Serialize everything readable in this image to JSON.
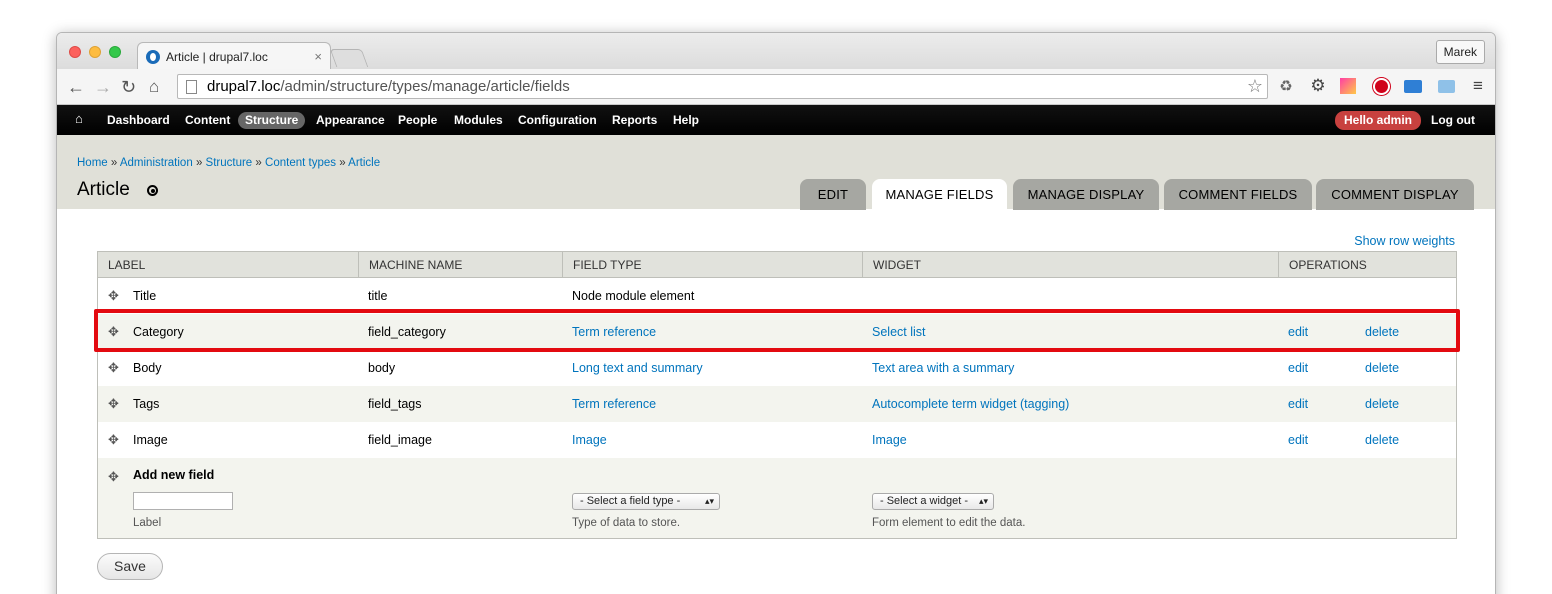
{
  "browser": {
    "tab_title": "Article | drupal7.loc",
    "tab_close": "×",
    "user_button": "Marek",
    "url_host": "drupal7.loc",
    "url_path": "/admin/structure/types/manage/article/fields"
  },
  "admin_menu": {
    "items": [
      "Dashboard",
      "Content",
      "Structure",
      "Appearance",
      "People",
      "Modules",
      "Configuration",
      "Reports",
      "Help"
    ],
    "active": "Structure",
    "hello": "Hello admin",
    "logout": "Log out"
  },
  "breadcrumb": {
    "items": [
      "Home",
      "Administration",
      "Structure",
      "Content types",
      "Article"
    ],
    "separator": "»"
  },
  "page_title": "Article",
  "page_tabs": [
    "EDIT",
    "MANAGE FIELDS",
    "MANAGE DISPLAY",
    "COMMENT FIELDS",
    "COMMENT DISPLAY"
  ],
  "active_tab": "MANAGE FIELDS",
  "show_row_weights": "Show row weights",
  "table": {
    "headers": [
      "LABEL",
      "MACHINE NAME",
      "FIELD TYPE",
      "WIDGET",
      "OPERATIONS"
    ],
    "rows": [
      {
        "label": "Title",
        "machine": "title",
        "type": "Node module element",
        "widget": "",
        "edit": "",
        "delete": ""
      },
      {
        "label": "Category",
        "machine": "field_category",
        "type": "Term reference",
        "widget": "Select list",
        "edit": "edit",
        "delete": "delete"
      },
      {
        "label": "Body",
        "machine": "body",
        "type": "Long text and summary",
        "widget": "Text area with a summary",
        "edit": "edit",
        "delete": "delete"
      },
      {
        "label": "Tags",
        "machine": "field_tags",
        "type": "Term reference",
        "widget": "Autocomplete term widget (tagging)",
        "edit": "edit",
        "delete": "delete"
      },
      {
        "label": "Image",
        "machine": "field_image",
        "type": "Image",
        "widget": "Image",
        "edit": "edit",
        "delete": "delete"
      }
    ],
    "add_new": {
      "title": "Add new field",
      "label_value": "",
      "label_hint": "Label",
      "type_select": "- Select a field type -",
      "type_hint": "Type of data to store.",
      "widget_select": "- Select a widget -",
      "widget_hint": "Form element to edit the data."
    }
  },
  "save_label": "Save",
  "colors": {
    "link": "#0074bd",
    "highlight": "#e30a10",
    "hello_badge": "#c8413f"
  }
}
